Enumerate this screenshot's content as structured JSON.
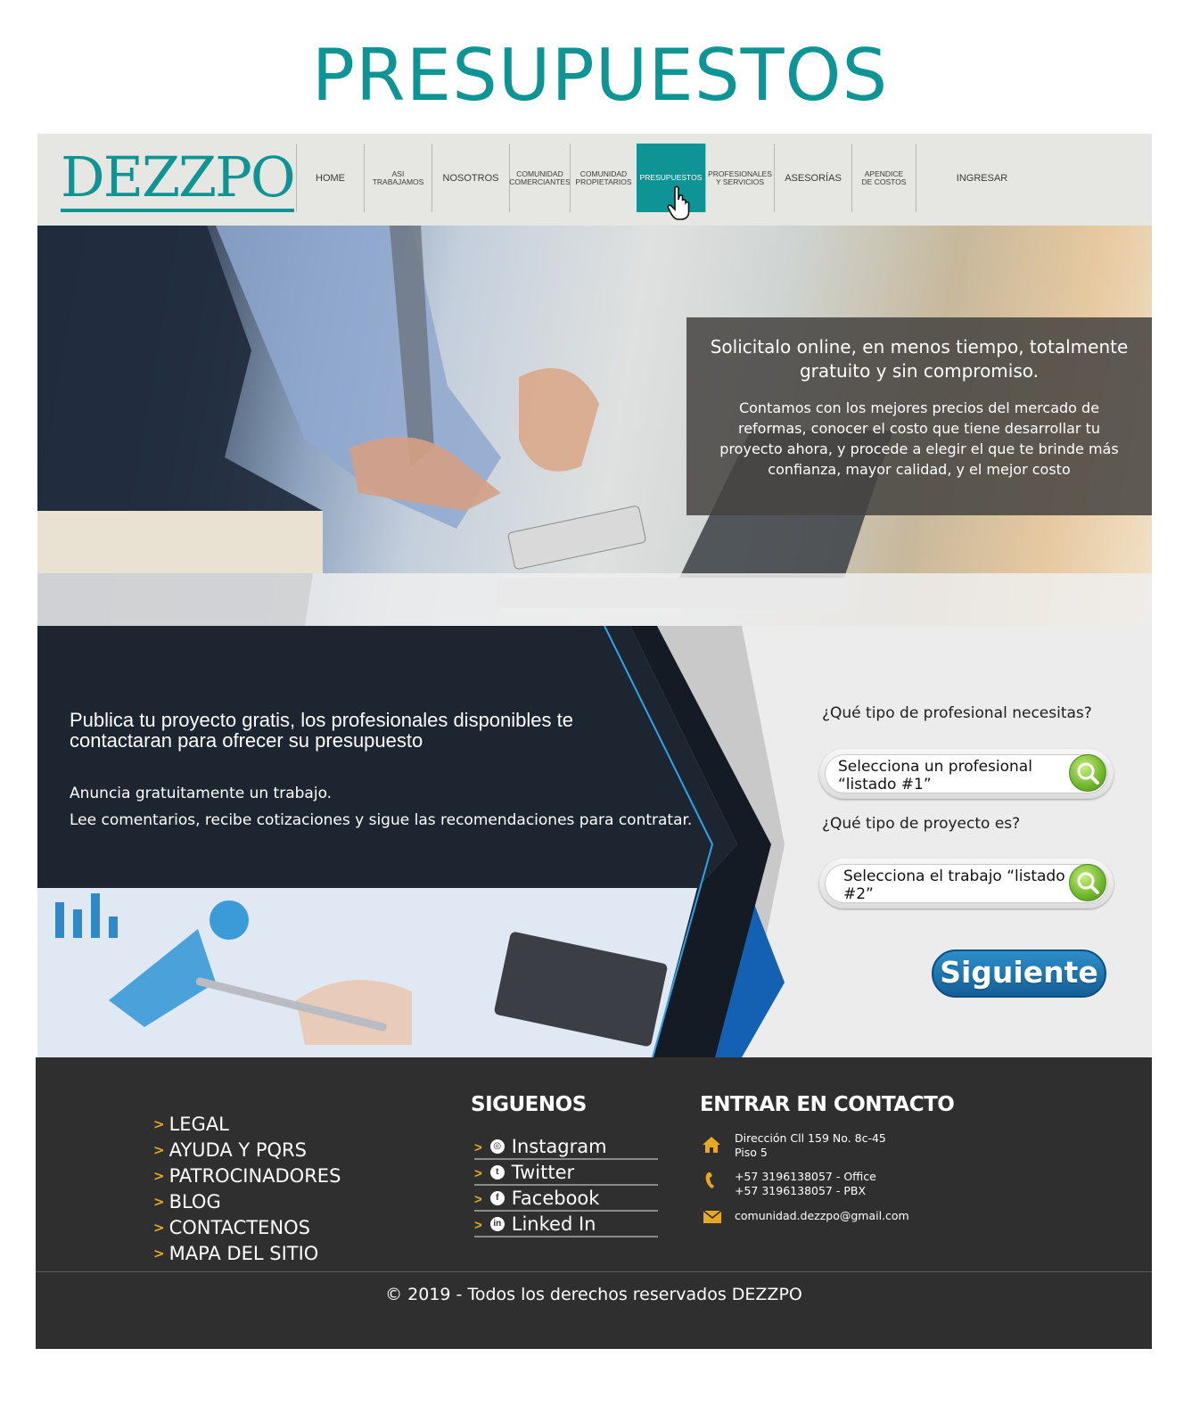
{
  "page": {
    "heading": "PRESUPUESTOS"
  },
  "navbar": {
    "logo": "DEZZPO",
    "items": [
      {
        "label": "HOME"
      },
      {
        "label": "ASI\nTRABAJAMOS"
      },
      {
        "label": "NOSOTROS"
      },
      {
        "label": "COMUNIDAD\nCOMERCIANTES"
      },
      {
        "label": "COMUNIDAD\nPROPIETARIOS"
      },
      {
        "label": "PRESUPUESTOS"
      },
      {
        "label": "PROFESIONALES\nY SERVICIOS"
      },
      {
        "label": "ASESORÍAS"
      },
      {
        "label": "APENDICE\nDE COSTOS"
      },
      {
        "label": "INGRESAR"
      }
    ],
    "active_item": "PRESUPUESTOS"
  },
  "hero": {
    "title": "Solicitalo online, en menos tiempo, totalmente gratuito y sin compromiso.",
    "text": "Contamos con los mejores precios del mercado de reformas, conocer el costo que tiene desarrollar tu proyecto ahora, y procede a elegir el que te brinde más confianza, mayor calidad, y el mejor costo"
  },
  "project": {
    "heading": "Publica tu proyecto gratis, los profesionales disponibles te contactaran para ofrecer su presupuesto",
    "line1": "Anuncia gratuitamente un trabajo.",
    "line2": "Lee comentarios, recibe cotizaciones y sigue las recomendaciones para contratar.",
    "q1_label": "¿Qué tipo de profesional necesitas?",
    "q1_value": "Selecciona un profesional “listado #1”",
    "q2_label": "¿Qué tipo de proyecto es?",
    "q2_value": "Selecciona el trabajo “listado #2”",
    "next_label": "Siguiente"
  },
  "footer": {
    "links": [
      "LEGAL",
      "AYUDA Y PQRS",
      "PATROCINADORES",
      "BLOG",
      "CONTACTENOS",
      "MAPA DEL SITIO"
    ],
    "follow_title": "SIGUENOS",
    "social": [
      {
        "label": "Instagram",
        "icon": "instagram-icon"
      },
      {
        "label": "Twitter",
        "icon": "twitter-icon"
      },
      {
        "label": "Facebook",
        "icon": "facebook-icon"
      },
      {
        "label": "Linked In",
        "icon": "linkedin-icon"
      }
    ],
    "contact_title": "ENTRAR EN CONTACTO",
    "address_line1": "Dirección  Cll 159 No. 8c-45",
    "address_line2": "Piso 5",
    "phone_line1": "+57 3196138057 - Office",
    "phone_line2": "+57 3196138057 - PBX",
    "email": "comunidad.dezzpo@gmail.com",
    "copyright": "© 2019 - Todos los derechos reservados DEZZPO"
  },
  "colors": {
    "brand_teal": "#0f9495",
    "footer_bg": "#2f2f2f",
    "accent_orange": "#e8a822",
    "button_blue": "#135f98"
  }
}
